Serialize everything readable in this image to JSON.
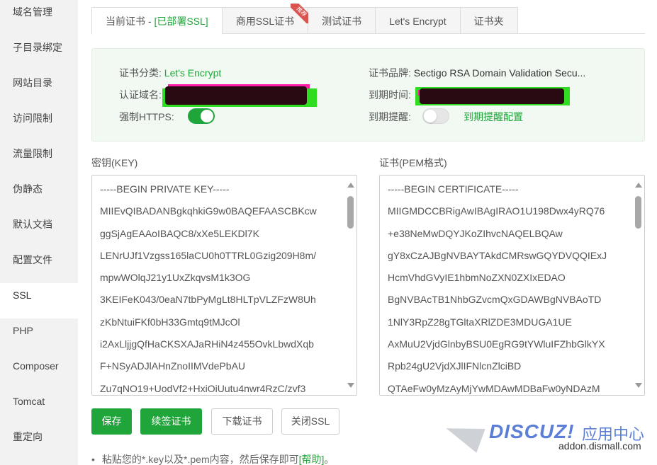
{
  "sidebar": {
    "items": [
      {
        "label": "域名管理"
      },
      {
        "label": "子目录绑定"
      },
      {
        "label": "网站目录"
      },
      {
        "label": "访问限制"
      },
      {
        "label": "流量限制"
      },
      {
        "label": "伪静态"
      },
      {
        "label": "默认文档"
      },
      {
        "label": "配置文件"
      },
      {
        "label": "SSL"
      },
      {
        "label": "PHP"
      },
      {
        "label": "Composer"
      },
      {
        "label": "Tomcat"
      },
      {
        "label": "重定向"
      }
    ],
    "active": "SSL"
  },
  "tabs": {
    "current_prefix": "当前证书 - ",
    "current_status": "[已部署SSL]",
    "commercial": "商用SSL证书",
    "commercial_badge": "推荐",
    "test": "测试证书",
    "letsencrypt": "Let's Encrypt",
    "folder": "证书夹"
  },
  "info": {
    "category_label": "证书分类:",
    "category_value": "Let's Encrypt",
    "domain_label": "认证域名:",
    "https_label": "强制HTTPS:",
    "https_enabled": true,
    "brand_label": "证书品牌:",
    "brand_value": "Sectigo RSA Domain Validation Secu...",
    "expire_label": "到期时间:",
    "remind_label": "到期提醒:",
    "remind_enabled": false,
    "remind_config": "到期提醒配置"
  },
  "key": {
    "label": "密钥(KEY)",
    "lines": [
      "-----BEGIN PRIVATE KEY-----",
      "MIIEvQIBADANBgkqhkiG9w0BAQEFAASCBKcw",
      "ggSjAgEAAoIBAQC8/xXe5LEKDl7K",
      "LENrUJf1Vzgss165laCU0h0TTRL0Gzig209H8m/",
      "mpwWOlqJ21y1UxZkqvsM1k3OG",
      "3KEIFeK043/0eaN7tbPyMgLt8HLTpVLZFzW8Uh",
      "zKbNtuiFKf0bH33Gmtq9tMJcOl",
      "i2AxLljjgQfHaCKSXAJaRHiN4z455OvkLbwdXqb",
      "F+NSyADJlAHnZnoIIMVdePbAU",
      "Zu7qNO19+UodVf2+HxiOiUutu4nwr4RzC/zvf3"
    ]
  },
  "cert": {
    "label": "证书(PEM格式)",
    "lines": [
      "-----BEGIN CERTIFICATE-----",
      "MIIGMDCCBRigAwIBAgIRAO1U198Dwx4yRQ76",
      "+e38NeMwDQYJKoZIhvcNAQELBQAw",
      "gY8xCzAJBgNVBAYTAkdCMRswGQYDVQQIExJ",
      "HcmVhdGVyIE1hbmNoZXN0ZXIxEDAO",
      "BgNVBAcTB1NhbGZvcmQxGDAWBgNVBAoTD",
      "1NlY3RpZ28gTGltaXRlZDE3MDUGA1UE",
      "AxMuU2VjdGlnbyBSU0EgRG9tYWluIFZhbGlkYX",
      "Rpb24gU2VjdXJlIFNlcnZlciBD",
      "QTAeFw0yMzAyMjYwMDAwMDBaFw0yNDAzM"
    ]
  },
  "buttons": {
    "save": "保存",
    "renew": "续签证书",
    "download": "下载证书",
    "close_ssl": "关闭SSL"
  },
  "help": {
    "bullet": "•",
    "text": "粘贴您的*.key以及*.pem内容，然后保存即可",
    "link": "[帮助]",
    "tail": "。"
  },
  "watermark": {
    "brand": "DISCUZ!",
    "sub": "应用中心",
    "url": "addon.dismall.com"
  },
  "colors": {
    "accent": "#20a53a",
    "info_bg": "#f1f9f2",
    "sidebar_bg": "#f2f2f2",
    "badge": "#d9534f"
  }
}
